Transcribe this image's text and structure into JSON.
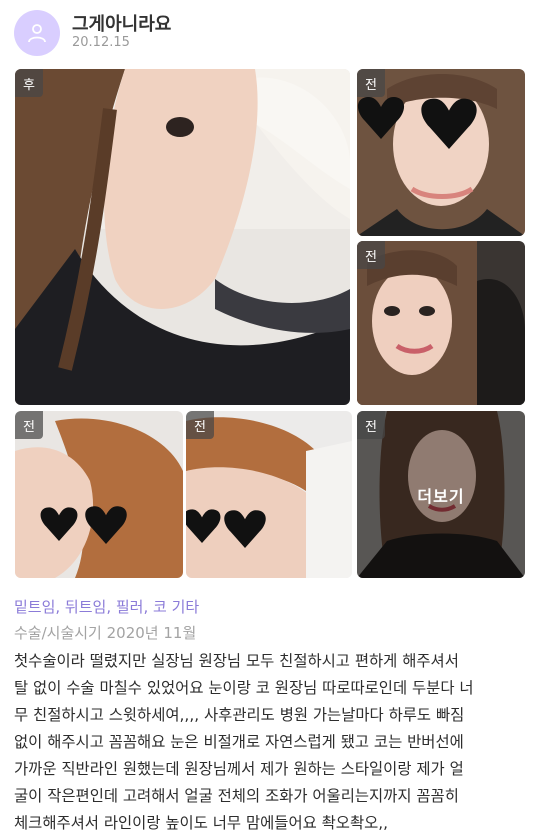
{
  "post": {
    "username": "그게아니라요",
    "date": "20.12.15",
    "photos": [
      {
        "tag": "후"
      },
      {
        "tag": "전"
      },
      {
        "tag": "전"
      },
      {
        "tag": "전"
      },
      {
        "tag": "전"
      },
      {
        "tag": "전",
        "overlay_label": "더보기"
      }
    ],
    "categories": "밑트임, 뒤트임, 필러, 코 기타",
    "surgery_period": "수술/시술시기 2020년 11월",
    "body": "첫수술이라 떨렸지만 실장님 원장님 모두 친절하시고 편하게 해주셔서\n탈 없이 수술 마칠수 있었어요 눈이랑 코 원장님 따로따로인데 두분다 너\n무 친절하시고 스윗하세여,,,, 사후관리도 병원 가는날마다 하루도 빠짐\n없이 해주시고 꼼꼼해요 눈은 비절개로 자연스럽게 됐고 코는 반버선에\n가까운 직반라인 원했는데 원장님께서 제가 원하는 스타일이랑 제가 얼\n굴이 작은편인데 고려해서 얼굴 전체의 조화가 어울리는지까지 꼼꼼히\n체크해주셔서 라인이랑 높이도 너무 맘에들어요 촥오촥오,,"
  },
  "colors": {
    "accent": "#8b7bd8",
    "avatar_bg": "#d9ceff"
  }
}
